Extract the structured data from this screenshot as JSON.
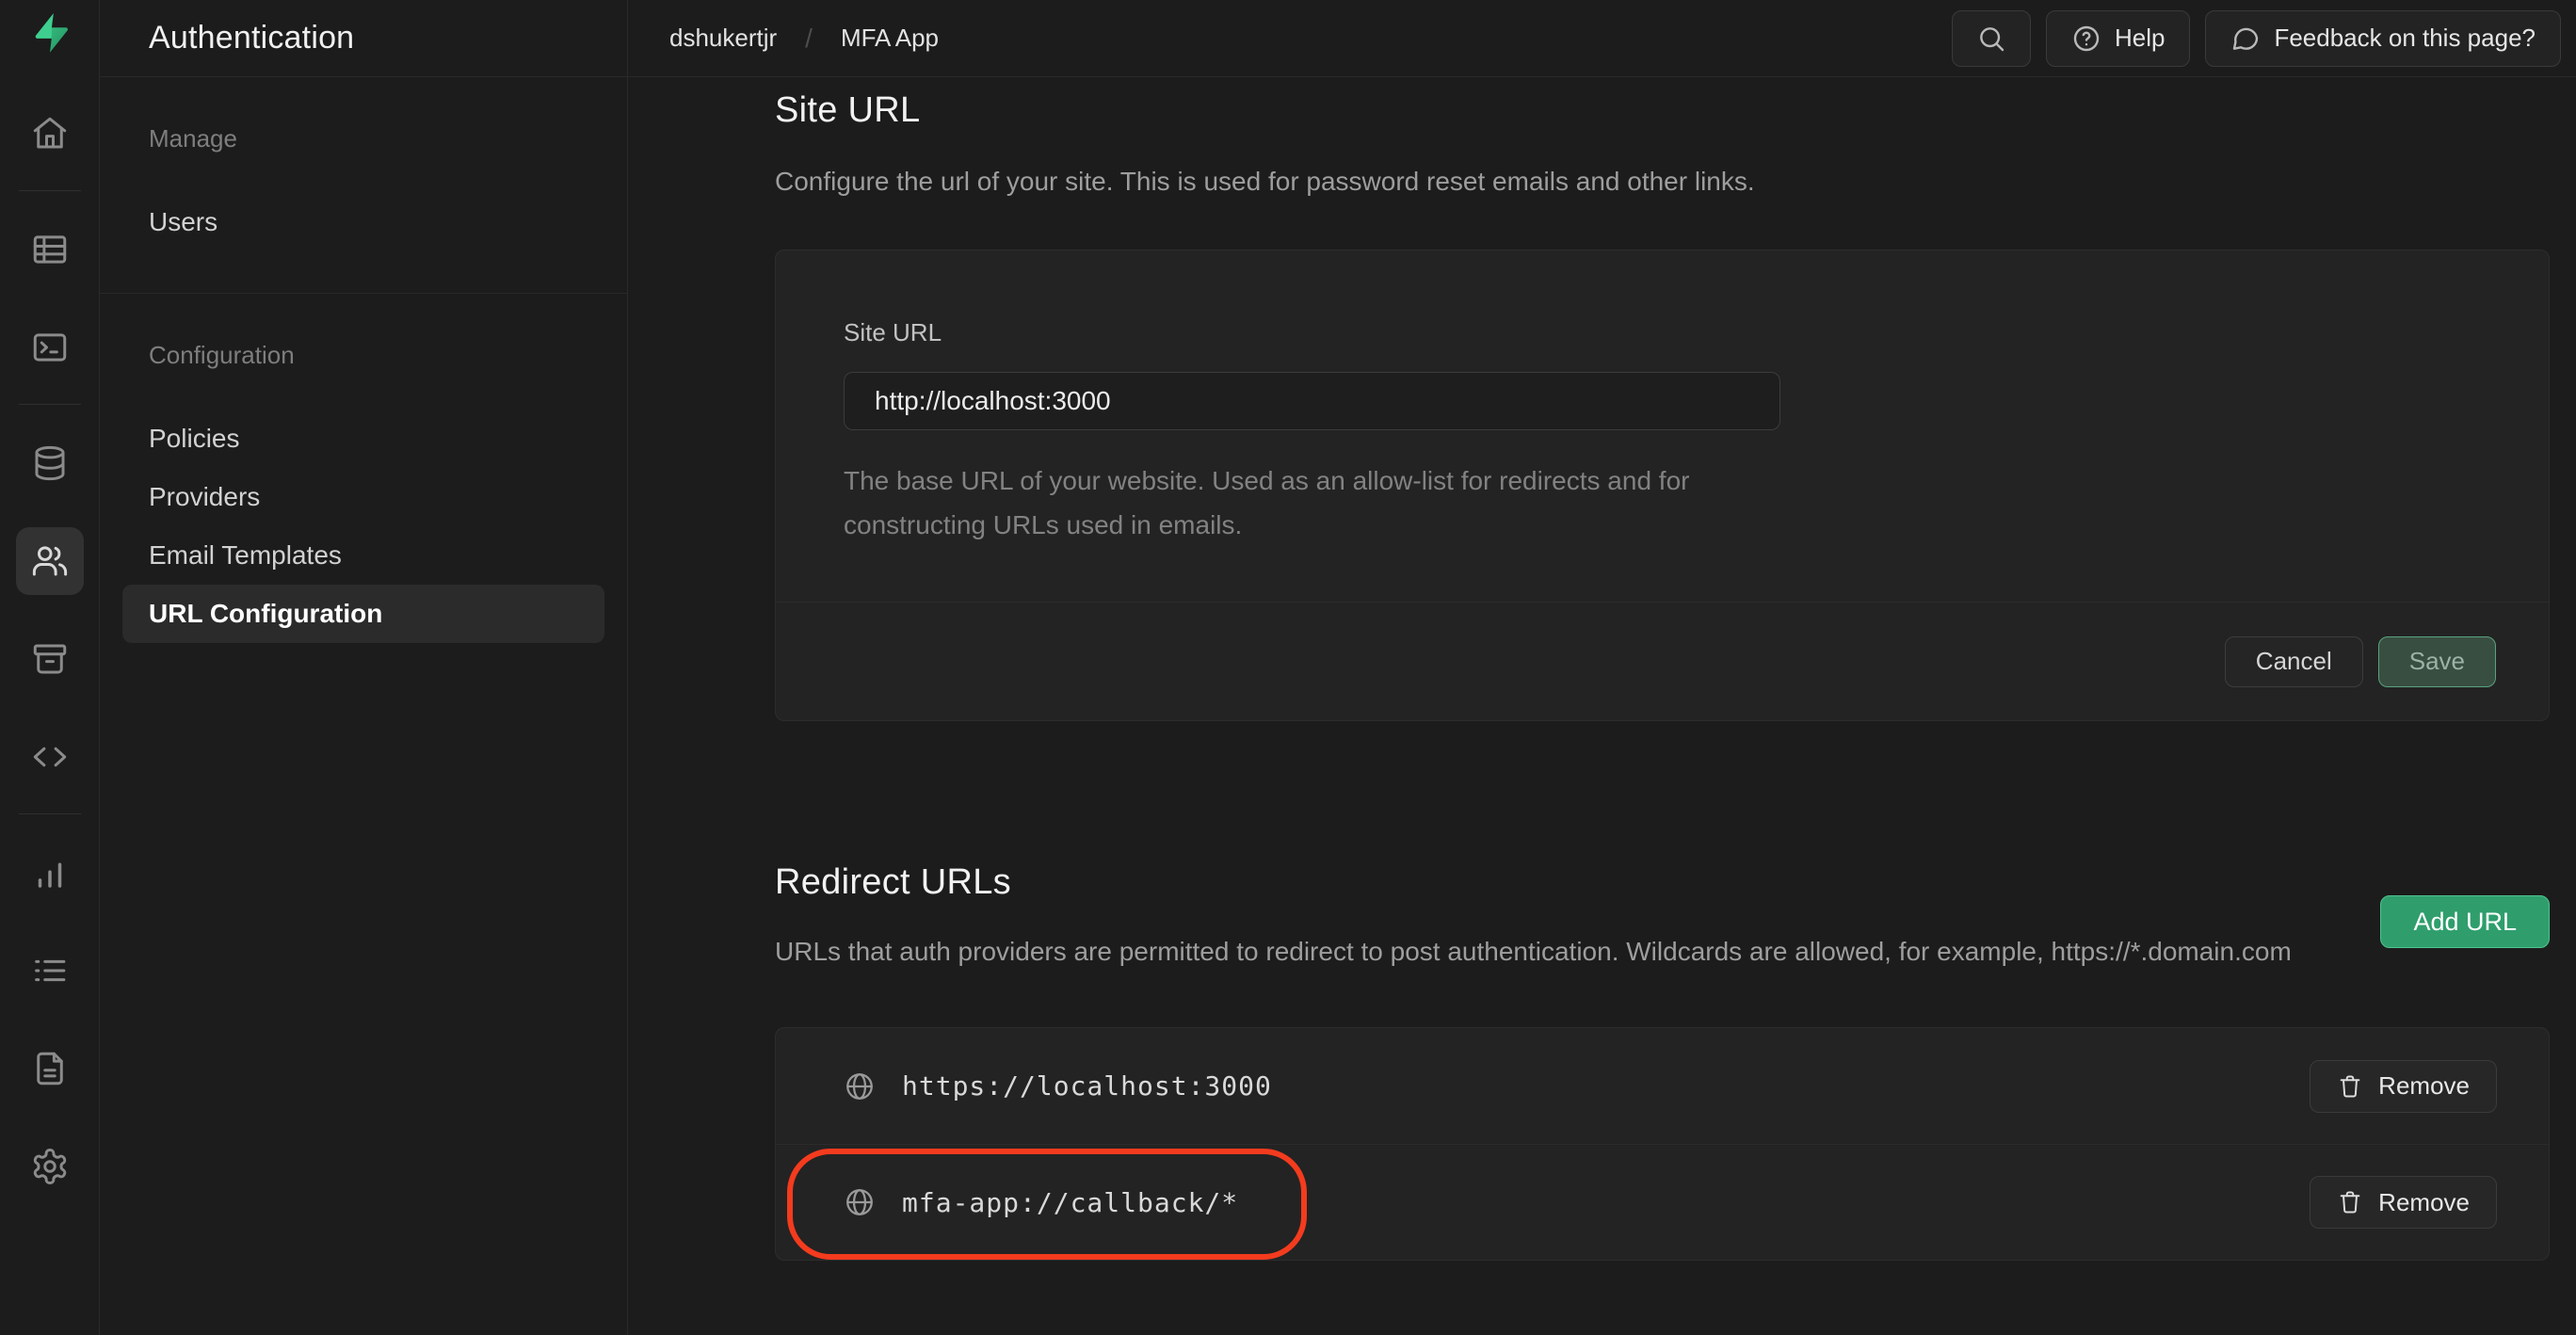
{
  "header": {
    "breadcrumb": {
      "org": "dshukertjr",
      "separator": "/",
      "project": "MFA App"
    },
    "help_label": "Help",
    "feedback_label": "Feedback on this page?"
  },
  "sidebar": {
    "title": "Authentication",
    "sections": [
      {
        "label": "Manage",
        "items": [
          {
            "label": "Users",
            "active": false
          }
        ]
      },
      {
        "label": "Configuration",
        "items": [
          {
            "label": "Policies",
            "active": false
          },
          {
            "label": "Providers",
            "active": false
          },
          {
            "label": "Email Templates",
            "active": false
          },
          {
            "label": "URL Configuration",
            "active": true
          }
        ]
      }
    ]
  },
  "site_url": {
    "heading": "Site URL",
    "description": "Configure the url of your site. This is used for password reset emails and other links.",
    "field_label": "Site URL",
    "field_value": "http://localhost:3000",
    "field_help": "The base URL of your website. Used as an allow-list for redirects and for constructing URLs used in emails.",
    "cancel_label": "Cancel",
    "save_label": "Save"
  },
  "redirect_urls": {
    "heading": "Redirect URLs",
    "description": "URLs that auth providers are permitted to redirect to post authentication. Wildcards are allowed, for example, https://*.domain.com",
    "add_button_label": "Add URL",
    "remove_label": "Remove",
    "urls": [
      "https://localhost:3000",
      "mfa-app://callback/*"
    ],
    "annotated_url_index": 1
  },
  "colors": {
    "brand_green": "#3ecf8e",
    "add_button_green": "#2f9e6c",
    "annotation_red": "#f43b1e",
    "background": "#1c1c1c",
    "card_background": "#232323"
  }
}
